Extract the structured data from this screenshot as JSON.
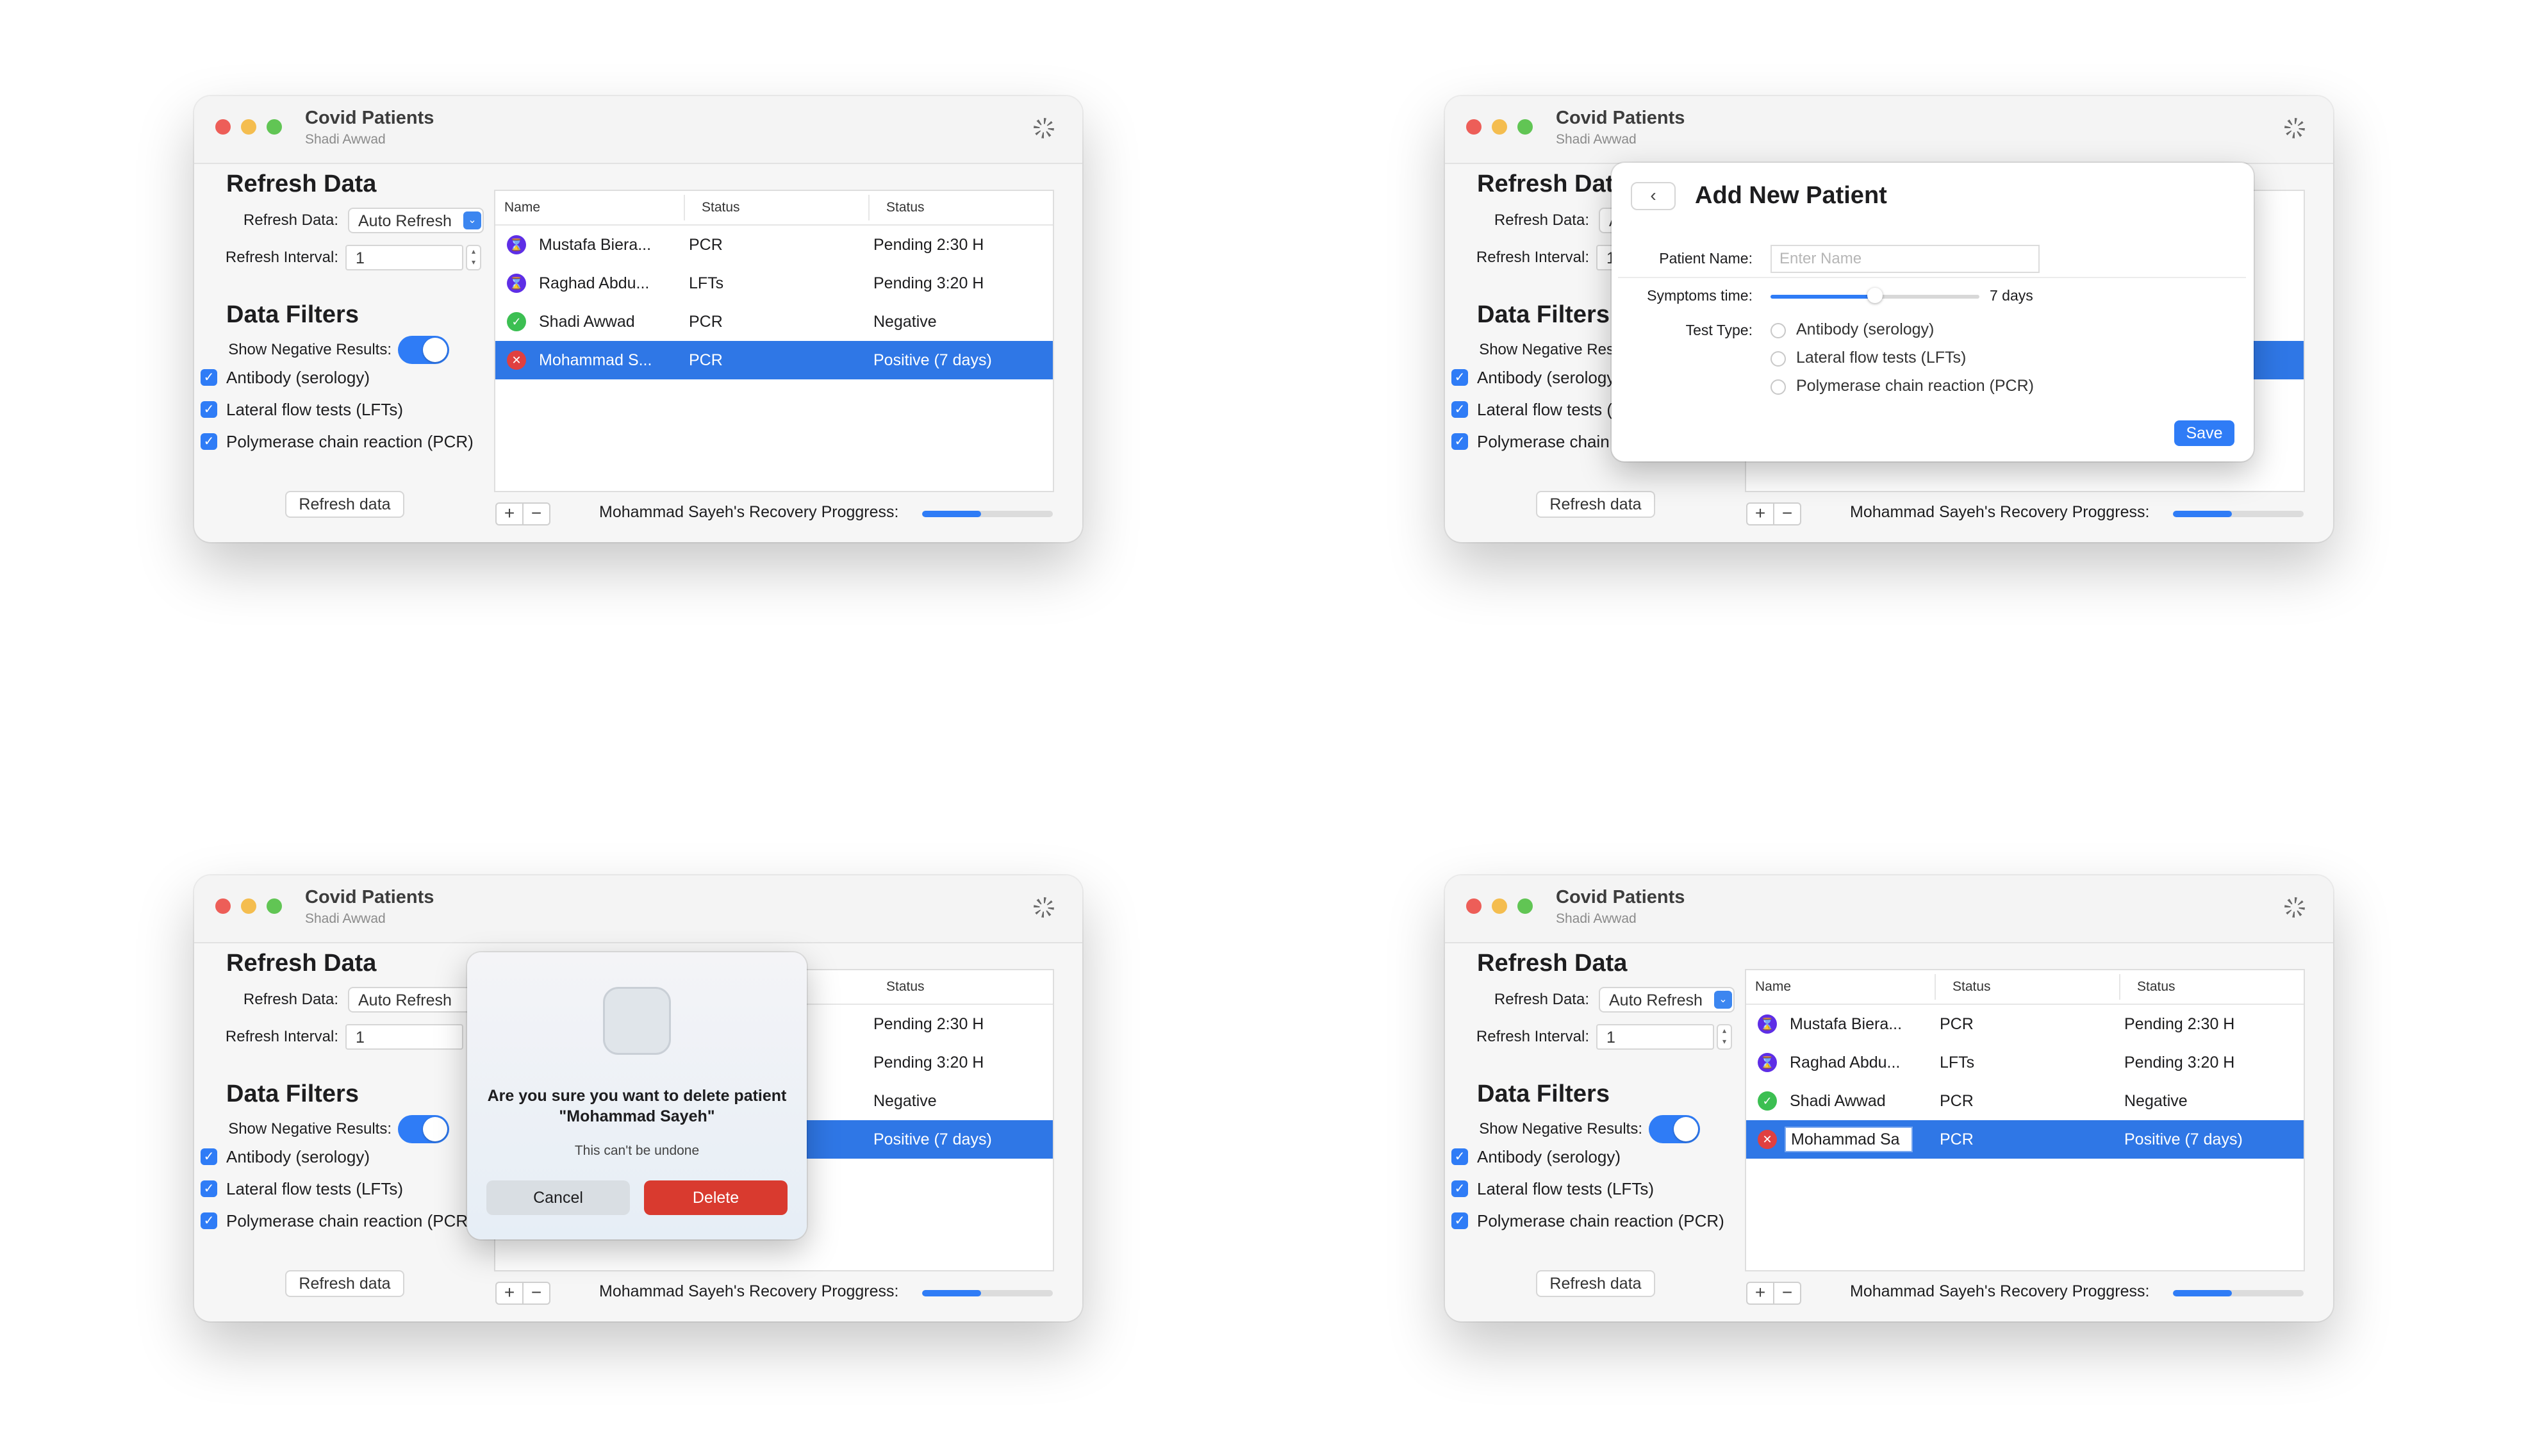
{
  "app": {
    "title": "Covid Patients",
    "subtitle": "Shadi Awwad"
  },
  "refresh": {
    "heading": "Refresh Data",
    "refresh_label": "Refresh Data:",
    "refresh_value": "Auto Refresh",
    "interval_label": "Refresh Interval:",
    "interval_value": "1",
    "button_label": "Refresh data"
  },
  "filters": {
    "heading": "Data Filters",
    "show_negative_label": "Show Negative Results:",
    "show_negative": true,
    "items": [
      {
        "label": "Antibody (serology)",
        "checked": true
      },
      {
        "label": "Lateral flow tests (LFTs)",
        "checked": true
      },
      {
        "label": "Polymerase chain reaction (PCR)",
        "checked": true
      }
    ]
  },
  "table": {
    "columns": [
      "Name",
      "Status",
      "Status"
    ],
    "rows": [
      {
        "icon": "hourglass-icon",
        "name": "Mustafa Biera...",
        "test": "PCR",
        "status": "Pending 2:30 H"
      },
      {
        "icon": "hourglass-icon",
        "name": "Raghad Abdu...",
        "test": "LFTs",
        "status": "Pending 3:20 H"
      },
      {
        "icon": "checkmark-icon",
        "name": "Shadi Awwad",
        "test": "PCR",
        "status": "Negative"
      },
      {
        "icon": "x-mark-icon",
        "name": "Mohammad S...",
        "test": "PCR",
        "status": "Positive (7 days)",
        "selected": true
      }
    ]
  },
  "footer": {
    "add_label": "+",
    "remove_label": "−",
    "progress_label": "Mohammad Sayeh's Recovery Proggress:",
    "progress_fraction": 0.45
  },
  "add_patient": {
    "title": "Add New Patient",
    "name_label": "Patient Name:",
    "name_placeholder": "Enter Name",
    "symptoms_label": "Symptoms time:",
    "symptoms_value": "7 days",
    "symptoms_fraction": 0.5,
    "test_label": "Test Type:",
    "test_options": [
      "Antibody (serology)",
      "Lateral flow tests (LFTs)",
      "Polymerase chain reaction (PCR)"
    ],
    "save_label": "Save"
  },
  "delete_alert": {
    "message": "Are you sure you want to delete patient \"Mohammad Sayeh\"",
    "subtext": "This can't be undone",
    "cancel_label": "Cancel",
    "delete_label": "Delete"
  },
  "inline_edit": {
    "value": "Mohammad Sa"
  },
  "glyphs": {
    "popup_arrow": "⌄",
    "stepper": "▴\n▾",
    "check": "✓",
    "back": "‹",
    "hourglass": "⌛",
    "checkmark": "✓",
    "xmark": "✕"
  }
}
